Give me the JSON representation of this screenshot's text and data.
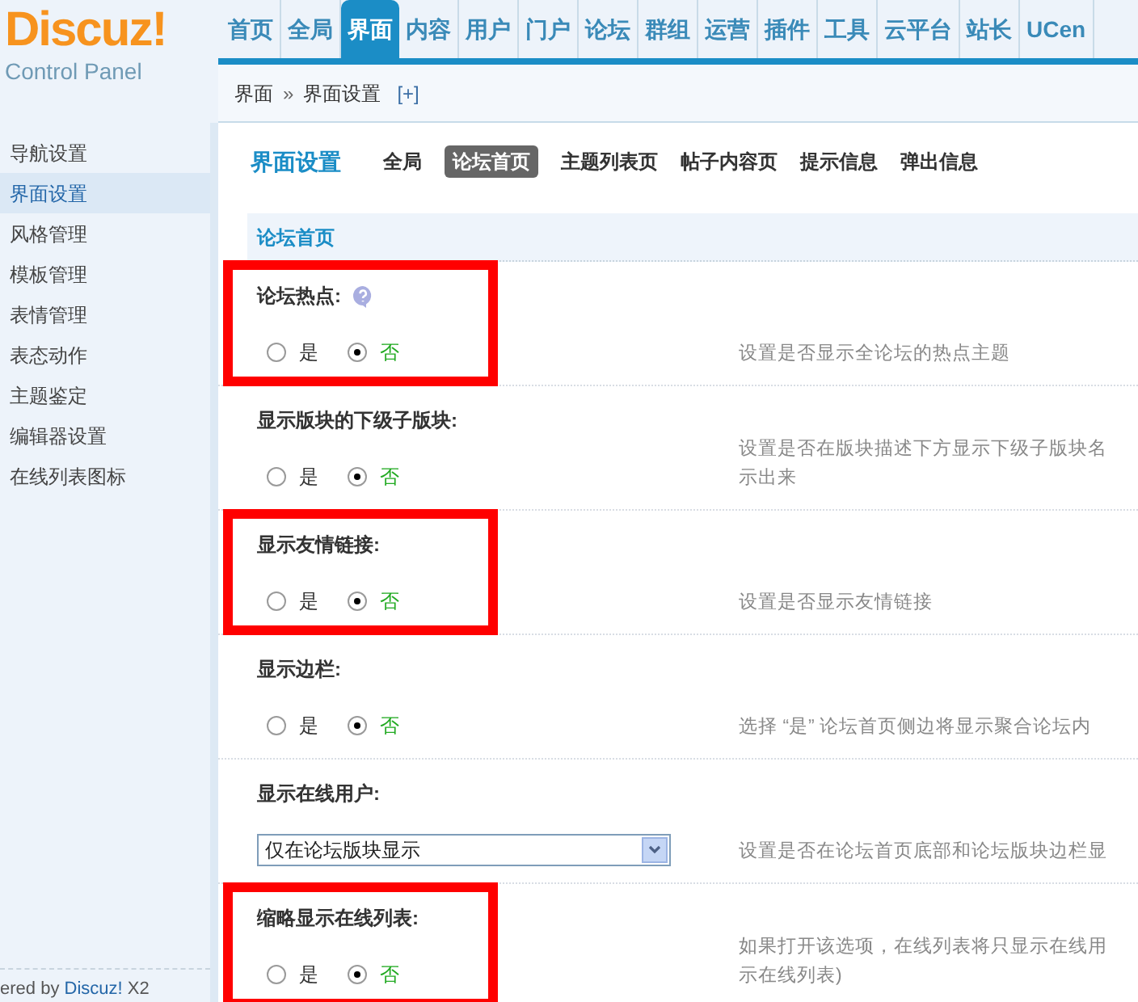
{
  "logo": {
    "brand": "Discuz!",
    "subtitle": "Control Panel"
  },
  "nav_tabs": [
    {
      "label": "首页",
      "selected": false
    },
    {
      "label": "全局",
      "selected": false
    },
    {
      "label": "界面",
      "selected": true
    },
    {
      "label": "内容",
      "selected": false
    },
    {
      "label": "用户",
      "selected": false
    },
    {
      "label": "门户",
      "selected": false
    },
    {
      "label": "论坛",
      "selected": false
    },
    {
      "label": "群组",
      "selected": false
    },
    {
      "label": "运营",
      "selected": false
    },
    {
      "label": "插件",
      "selected": false
    },
    {
      "label": "工具",
      "selected": false
    },
    {
      "label": "云平台",
      "selected": false
    },
    {
      "label": "站长",
      "selected": false
    },
    {
      "label": "UCen",
      "selected": false
    }
  ],
  "breadcrumb": {
    "items": [
      "界面",
      "界面设置"
    ],
    "separator": "»",
    "add": "[+]"
  },
  "sidebar": {
    "items": [
      {
        "label": "导航设置",
        "selected": false
      },
      {
        "label": "界面设置",
        "selected": true
      },
      {
        "label": "风格管理",
        "selected": false
      },
      {
        "label": "模板管理",
        "selected": false
      },
      {
        "label": "表情管理",
        "selected": false
      },
      {
        "label": "表态动作",
        "selected": false
      },
      {
        "label": "主题鉴定",
        "selected": false
      },
      {
        "label": "编辑器设置",
        "selected": false
      },
      {
        "label": "在线列表图标",
        "selected": false
      }
    ],
    "footer": {
      "prefix": "ered by ",
      "link": "Discuz!",
      "suffix": " X2"
    }
  },
  "content": {
    "title": "界面设置",
    "tabs": [
      {
        "label": "全局",
        "selected": false
      },
      {
        "label": "论坛首页",
        "selected": true
      },
      {
        "label": "主题列表页",
        "selected": false
      },
      {
        "label": "帖子内容页",
        "selected": false
      },
      {
        "label": "提示信息",
        "selected": false
      },
      {
        "label": "弹出信息",
        "selected": false
      }
    ],
    "section": "论坛首页",
    "settings": [
      {
        "kind": "radio",
        "label": "论坛热点:",
        "help": true,
        "highlighted": true,
        "options": [
          {
            "label": "是",
            "selected": false
          },
          {
            "label": "否",
            "selected": true
          }
        ],
        "description": [
          "设置是否显示全论坛的热点主题"
        ]
      },
      {
        "kind": "radio",
        "label": "显示版块的下级子版块:",
        "help": false,
        "highlighted": false,
        "options": [
          {
            "label": "是",
            "selected": false
          },
          {
            "label": "否",
            "selected": true
          }
        ],
        "description": [
          "设置是否在版块描述下方显示下级子版块名",
          "示出来"
        ]
      },
      {
        "kind": "radio",
        "label": "显示友情链接:",
        "help": false,
        "highlighted": true,
        "options": [
          {
            "label": "是",
            "selected": false
          },
          {
            "label": "否",
            "selected": true
          }
        ],
        "description": [
          "设置是否显示友情链接"
        ]
      },
      {
        "kind": "radio",
        "label": "显示边栏:",
        "help": false,
        "highlighted": false,
        "options": [
          {
            "label": "是",
            "selected": false
          },
          {
            "label": "否",
            "selected": true
          }
        ],
        "description": [
          "选择 “是” 论坛首页侧边将显示聚合论坛内"
        ]
      },
      {
        "kind": "select",
        "label": "显示在线用户:",
        "help": false,
        "highlighted": false,
        "value": "仅在论坛版块显示",
        "description": [
          "设置是否在论坛首页底部和论坛版块边栏显"
        ]
      },
      {
        "kind": "radio",
        "label": "缩略显示在线列表:",
        "help": false,
        "highlighted": true,
        "options": [
          {
            "label": "是",
            "selected": false
          },
          {
            "label": "否",
            "selected": true
          }
        ],
        "description": [
          "如果打开该选项，在线列表将只显示在线用",
          "示在线列表)"
        ]
      }
    ]
  }
}
